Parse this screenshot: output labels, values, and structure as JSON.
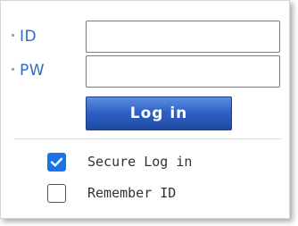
{
  "login_form": {
    "id_label": "ID",
    "pw_label": "PW",
    "id_value": "",
    "pw_value": "",
    "login_button": "Log in",
    "secure_login": {
      "label": "Secure Log in",
      "checked": true
    },
    "remember_id": {
      "label": "Remember ID",
      "checked": false
    }
  },
  "colors": {
    "label_blue": "#2f6bbf",
    "button_blue": "#2f62c6",
    "checkbox_blue": "#1a73e8"
  }
}
